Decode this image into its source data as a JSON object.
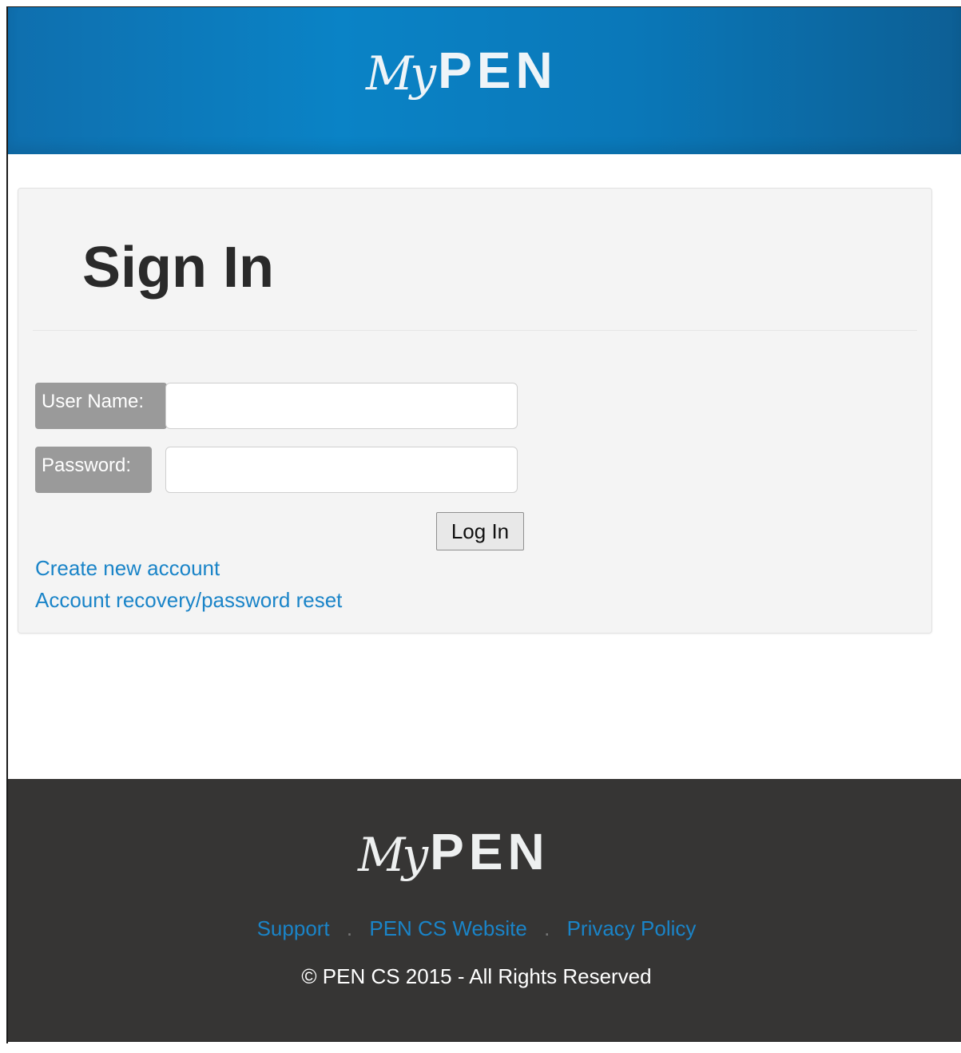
{
  "header": {
    "logo_script": "My",
    "logo_bold": "PEN"
  },
  "signin": {
    "title": "Sign In",
    "username_label": "User Name:",
    "username_value": "",
    "password_label": "Password:",
    "password_value": "",
    "login_button": "Log In",
    "create_account_link": "Create new account",
    "recovery_link": "Account recovery/password reset"
  },
  "footer": {
    "logo_script": "My",
    "logo_bold": "PEN",
    "links": [
      "Support",
      "PEN CS Website",
      "Privacy Policy"
    ],
    "separator": ".",
    "copyright": "© PEN CS 2015 - All Rights Reserved"
  },
  "colors": {
    "header_blue": "#0a83c6",
    "footer_dark": "#363534",
    "link_blue": "#1a84c8",
    "label_gray": "#9a9a9a"
  }
}
